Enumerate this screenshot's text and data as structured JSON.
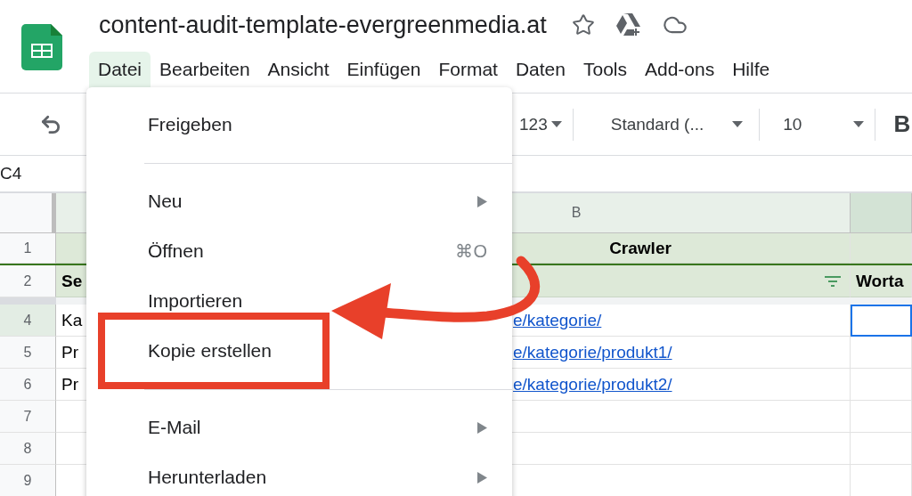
{
  "title": "content-audit-template-evergreenmedia.at",
  "menus": [
    {
      "label": "Datei",
      "selected": true
    },
    {
      "label": "Bearbeiten",
      "selected": false
    },
    {
      "label": "Ansicht",
      "selected": false
    },
    {
      "label": "Einfügen",
      "selected": false
    },
    {
      "label": "Format",
      "selected": false
    },
    {
      "label": "Daten",
      "selected": false
    },
    {
      "label": "Tools",
      "selected": false
    },
    {
      "label": "Add-ons",
      "selected": false
    },
    {
      "label": "Hilfe",
      "selected": false
    }
  ],
  "toolbar": {
    "number_format": "123",
    "font": "Standard (...",
    "font_size": "10",
    "bold": "B"
  },
  "name_box": "C4",
  "columns": [
    {
      "label": "B",
      "selected": false
    },
    {
      "selected": true
    }
  ],
  "rows": [
    {
      "number": "1",
      "selected": false,
      "kind": "header",
      "col_b": "Crawler"
    },
    {
      "number": "2",
      "selected": false,
      "kind": "header",
      "col_a": "Se",
      "filter": true,
      "col_c": "Worta"
    },
    {
      "number": "4",
      "selected": true,
      "kind": "data",
      "hidden_above": true,
      "col_a": "Ka",
      "col_b": "e/kategorie/",
      "c_active": true
    },
    {
      "number": "5",
      "selected": false,
      "kind": "data",
      "col_a": "Pr",
      "col_b": "e/kategorie/produkt1/",
      "c_active": false
    },
    {
      "number": "6",
      "selected": false,
      "kind": "data",
      "col_a": "Pr",
      "col_b": "e/kategorie/produkt2/",
      "c_active": false
    },
    {
      "number": "7",
      "selected": false,
      "kind": "data",
      "c_active": false
    },
    {
      "number": "8",
      "selected": false,
      "kind": "data",
      "c_active": false
    },
    {
      "number": "9",
      "selected": false,
      "kind": "data",
      "c_active": false
    }
  ],
  "menu": [
    {
      "kind": "item",
      "label": "Freigeben",
      "highlighted": false
    },
    {
      "kind": "divider"
    },
    {
      "kind": "item",
      "label": "Neu",
      "submenu": true,
      "highlighted": false
    },
    {
      "kind": "item",
      "label": "Öffnen",
      "shortcut": "⌘O",
      "highlighted": false
    },
    {
      "kind": "item",
      "label": "Importieren",
      "highlighted": false
    },
    {
      "kind": "item",
      "label": "Kopie erstellen",
      "highlighted": true
    },
    {
      "kind": "divider"
    },
    {
      "kind": "item",
      "label": "E-Mail",
      "submenu": true,
      "highlighted": false
    },
    {
      "kind": "item",
      "label": "Herunterladen",
      "submenu": true,
      "highlighted": false
    }
  ]
}
